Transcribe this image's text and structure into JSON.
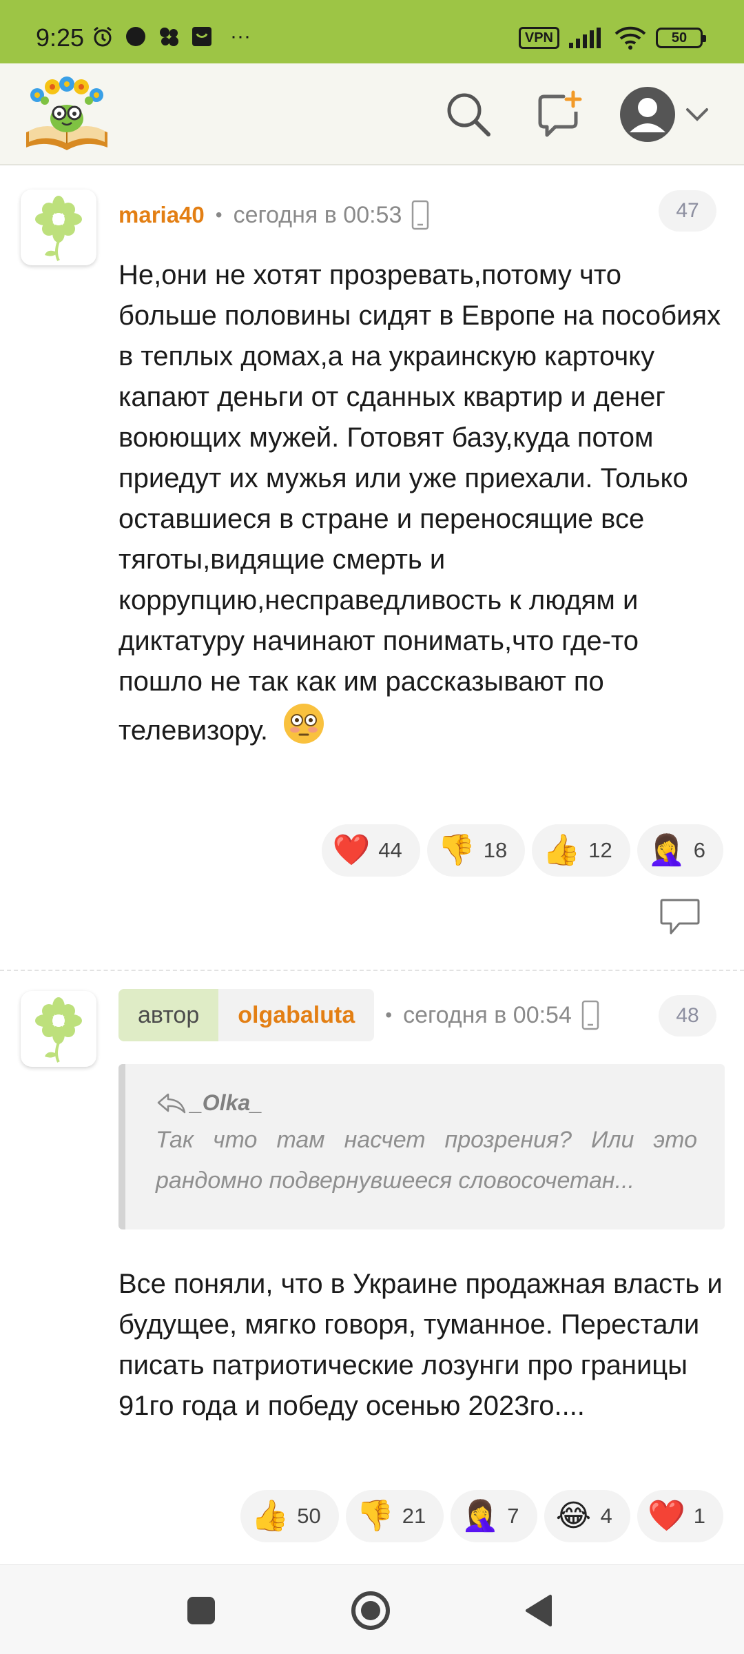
{
  "status_bar": {
    "time": "9:25",
    "vpn": "VPN",
    "battery": "50",
    "more": "···",
    "colors": {
      "background": "#9dc545"
    }
  },
  "header": {
    "icons": [
      "logo-flower-book",
      "search-icon",
      "new-post-icon",
      "profile-avatar-icon",
      "chevron-down-icon"
    ]
  },
  "comments": [
    {
      "username": "maria40",
      "time": "сегодня в 00:53",
      "number": "47",
      "text": "Не,они не хотят прозревать,потому что больше половины сидят в Европе на пособиях в теплых домах,а на украинскую карточку капают деньги от сданных квартир и денег воюющих мужей. Готовят базу,куда потом приедут их мужья или уже приехали. Только оставшиеся в стране и переносящие все тяготы,видящие смерть и коррупцию,несправедливость к людям и диктатуру начинают понимать,что где-то пошло не так как им рассказывают по телевизору.",
      "reactions": [
        {
          "icon": "heart-icon",
          "glyph": "❤️",
          "count": "44"
        },
        {
          "icon": "thumbs-down-icon",
          "glyph": "👎",
          "count": "18"
        },
        {
          "icon": "thumbs-up-icon",
          "glyph": "👍",
          "count": "12"
        },
        {
          "icon": "facepalm-icon",
          "glyph": "🤦‍♀️",
          "count": "6"
        }
      ]
    },
    {
      "author_label": "автор",
      "username": "olgabaluta",
      "time": "сегодня в 00:54",
      "number": "48",
      "quote": {
        "author": "_Olka_",
        "line1": "Так что там насчет прозрения? Или это",
        "line2": "рандомно подвернувшееся словосочетан..."
      },
      "text": "Все поняли, что в Украине продажная власть и будущее, мягко говоря, туманное. Перестали писать патриотические лозунги про границы 91го года и победу осенью 2023го....",
      "reactions": [
        {
          "icon": "thumbs-up-icon",
          "glyph": "👍",
          "count": "50"
        },
        {
          "icon": "thumbs-down-icon",
          "glyph": "👎",
          "count": "21"
        },
        {
          "icon": "facepalm-icon",
          "glyph": "🤦‍♀️",
          "count": "7"
        },
        {
          "icon": "laughing-icon",
          "glyph": "😂",
          "count": "4"
        },
        {
          "icon": "heart-icon",
          "glyph": "❤️",
          "count": "1"
        }
      ]
    }
  ],
  "colors": {
    "username": "#e37f14",
    "author_label_bg": "#dfecc6",
    "reaction_bg": "#f3f3f3"
  }
}
